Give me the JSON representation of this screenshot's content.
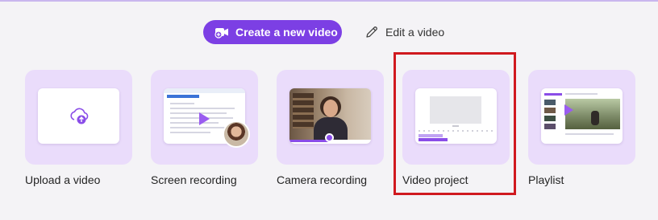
{
  "header": {
    "create_label": "Create a new video",
    "edit_label": "Edit a video"
  },
  "cards": [
    {
      "id": "upload",
      "label": "Upload a video",
      "icon": "cloud-upload-icon"
    },
    {
      "id": "screen",
      "label": "Screen recording",
      "icon": "screen-recording-thumbnail"
    },
    {
      "id": "camera",
      "label": "Camera recording",
      "icon": "camera-recording-thumbnail"
    },
    {
      "id": "project",
      "label": "Video project",
      "icon": "video-project-thumbnail"
    },
    {
      "id": "playlist",
      "label": "Playlist",
      "icon": "playlist-thumbnail"
    }
  ],
  "colors": {
    "accent": "#7c3fe4",
    "card_bg": "#eadcfb",
    "page_bg": "#f4f3f6",
    "highlight": "#d0191f"
  }
}
